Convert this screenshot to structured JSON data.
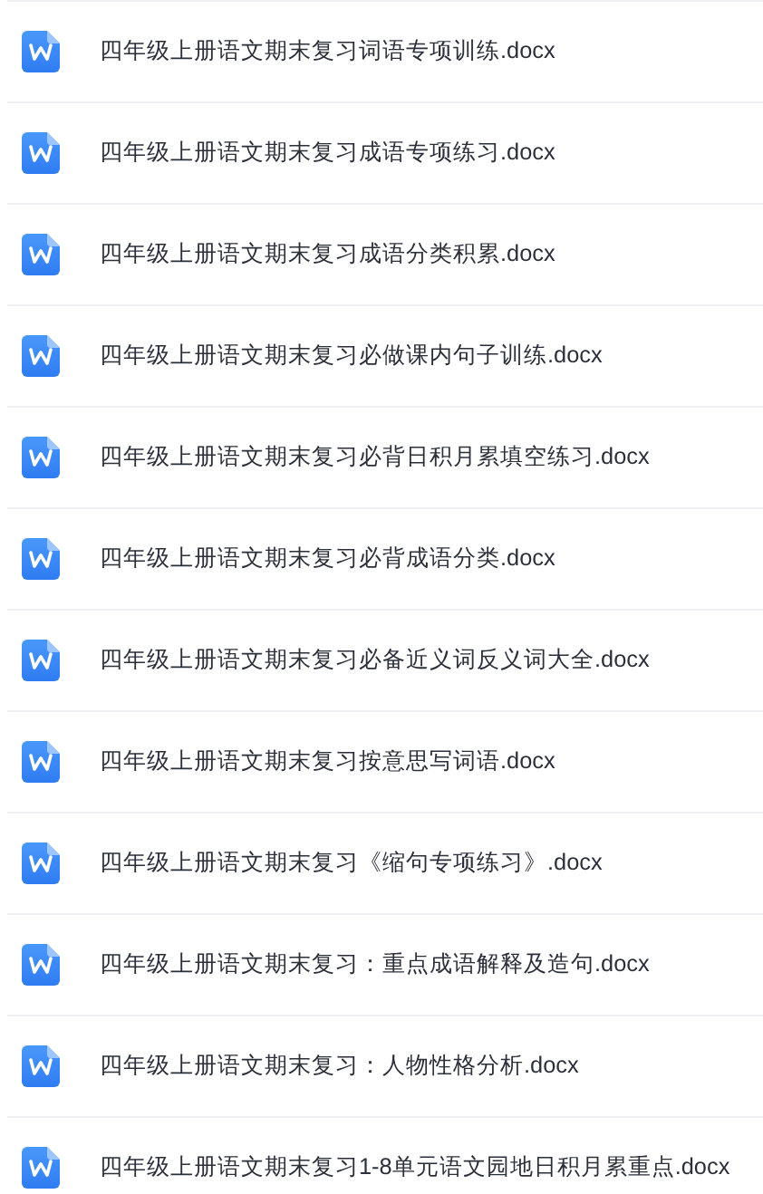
{
  "files": [
    {
      "name": "四年级上册语文期末复习词语专项训练.docx"
    },
    {
      "name": "四年级上册语文期末复习成语专项练习.docx"
    },
    {
      "name": "四年级上册语文期末复习成语分类积累.docx"
    },
    {
      "name": "四年级上册语文期末复习必做课内句子训练.docx"
    },
    {
      "name": "四年级上册语文期末复习必背日积月累填空练习.docx"
    },
    {
      "name": "四年级上册语文期末复习必背成语分类.docx"
    },
    {
      "name": "四年级上册语文期末复习必备近义词反义词大全.docx"
    },
    {
      "name": "四年级上册语文期末复习按意思写词语.docx"
    },
    {
      "name": "四年级上册语文期末复习《缩句专项练习》.docx"
    },
    {
      "name": "四年级上册语文期末复习：重点成语解释及造句.docx"
    },
    {
      "name": "四年级上册语文期末复习：人物性格分析.docx"
    },
    {
      "name": "四年级上册语文期末复习1-8单元语文园地日积月累重点.docx"
    }
  ]
}
